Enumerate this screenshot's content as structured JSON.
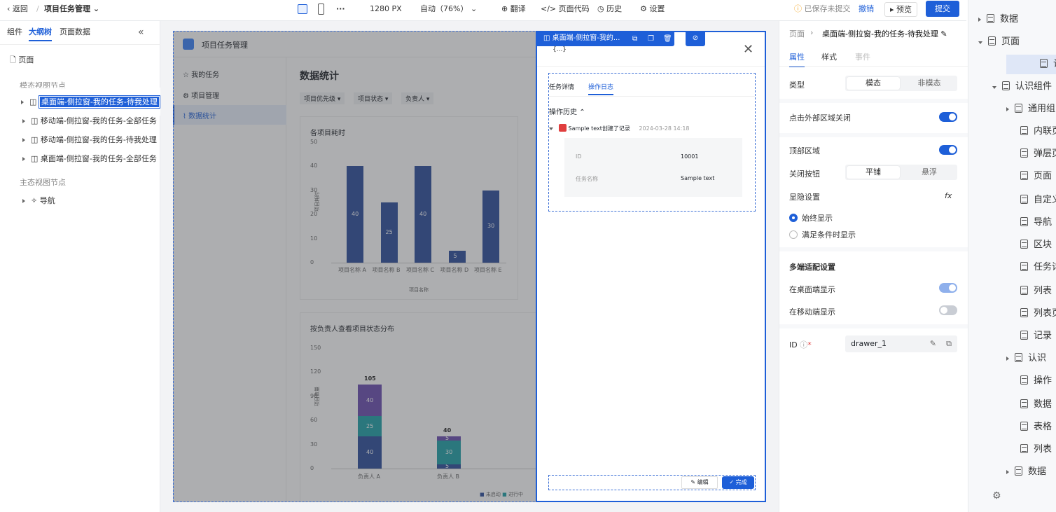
{
  "topbar": {
    "back": "返回",
    "project": "项目任务管理",
    "size": "1280 PX",
    "zoom": "自动（76%）",
    "translate": "翻译",
    "code": "页面代码",
    "history": "历史",
    "settings": "设置",
    "unsaved": "已保存未提交",
    "undo": "撤销",
    "preview": "预览",
    "submit": "提交"
  },
  "left": {
    "tabs": [
      "组件",
      "大纲树",
      "页面数据"
    ],
    "page": "页面",
    "modal_group": "模态视图节点",
    "nodes": [
      "桌面端-侧拉窗-我的任务-待我处理",
      "移动端-侧拉窗-我的任务-全部任务",
      "移动端-侧拉窗-我的任务-待我处理",
      "桌面端-侧拉窗-我的任务-全部任务"
    ],
    "main_group": "主态视图节点",
    "nav": "导航"
  },
  "app": {
    "title": "项目任务管理",
    "menu": [
      "我的任务",
      "项目管理",
      "数据统计"
    ],
    "heading": "数据统计",
    "filters": [
      "项目优先级",
      "项目状态",
      "负责人"
    ],
    "chart1_title": "各项目耗时",
    "chart2_title": "按负责人查看项目状态分布",
    "legend": [
      "未启动",
      "进行中"
    ]
  },
  "chart_data": [
    {
      "type": "bar",
      "title": "各项目耗时",
      "xlabel": "项目名称",
      "ylabel": "项目耗时",
      "categories": [
        "项目名称 A",
        "项目名称 B",
        "项目名称 C",
        "项目名称 D",
        "项目名称 E"
      ],
      "values": [
        40,
        25,
        40,
        5,
        30
      ],
      "yticks": [
        "0",
        "10",
        "20",
        "30",
        "40",
        "50"
      ],
      "ylim": [
        0,
        50
      ]
    },
    {
      "type": "bar",
      "title": "按负责人查看项目状态分布",
      "ylabel": "项目数量",
      "categories": [
        "负责人 A",
        "负责人 B"
      ],
      "totals": [
        "105",
        "40"
      ],
      "stacks": [
        [
          {
            "label": "40",
            "value": 40
          },
          {
            "label": "25",
            "value": 25
          },
          {
            "label": "40",
            "value": 40
          }
        ],
        [
          {
            "label": "5",
            "value": 5
          },
          {
            "label": "30",
            "value": 30
          },
          {
            "label": "5",
            "value": 5
          }
        ]
      ],
      "yticks": [
        "0",
        "30",
        "60",
        "90",
        "120",
        "150"
      ],
      "ylim": [
        0,
        150
      ]
    }
  ],
  "drawer": {
    "badge": "桌面端-侧拉窗-我的...",
    "tabs": [
      "任务详情",
      "操作日志"
    ],
    "section": "操作历史",
    "log_text": "Sample text创建了记录",
    "log_time": "2024-03-28 14:18",
    "fields": [
      {
        "k": "ID",
        "v": "10001"
      },
      {
        "k": "任务名称",
        "v": "Sample text"
      }
    ],
    "edit": "编辑",
    "done": "完成"
  },
  "right": {
    "crumb_root": "页面",
    "crumb_node": "桌面端-侧拉窗-我的任务-待我处理",
    "tabs": [
      "属性",
      "样式",
      "事件"
    ],
    "type_label": "类型",
    "type_opts": [
      "模态",
      "非模态"
    ],
    "outside_close": "点击外部区域关闭",
    "top_area": "顶部区域",
    "close_btn": "关闭按钮",
    "close_opts": [
      "平铺",
      "悬浮"
    ],
    "visibility": "显隐设置",
    "vis_opts": [
      "始终显示",
      "满足条件时显示"
    ],
    "multi": "多端适配设置",
    "desktop": "在桌面端显示",
    "mobile": "在移动端显示",
    "id_label": "ID",
    "id_value": "drawer_1"
  },
  "far": {
    "items": [
      "数据",
      "页面",
      "认识页面",
      "认识组件",
      "通用组",
      "内联页",
      "弹层页",
      "页面",
      "自定义",
      "导航",
      "区块",
      "任务详",
      "列表",
      "列表页",
      "记录",
      "认识",
      "操作",
      "数据",
      "表格",
      "列表",
      "数据"
    ]
  }
}
